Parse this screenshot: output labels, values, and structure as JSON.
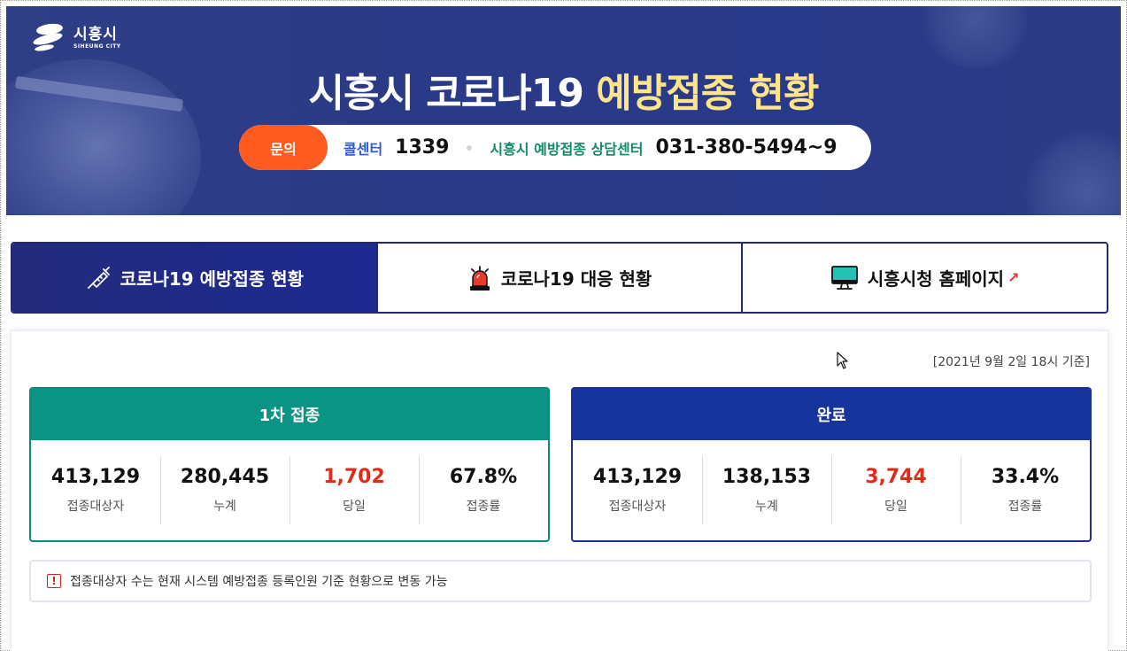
{
  "banner": {
    "logo_ko": "시흥시",
    "logo_en": "SIHEUNG CITY",
    "title_main": "시흥시 코로나19 ",
    "title_highlight": "예방접종 현황",
    "contact": {
      "ask_label": "문의",
      "call_center_label": "콜센터",
      "call_center_number": "1339",
      "consult_label": "시흥시 예방접종 상담센터",
      "consult_number": "031-380-5494~9"
    }
  },
  "tabs": [
    {
      "label": "코로나19 예방접종 현황",
      "icon": "syringe-icon",
      "active": true
    },
    {
      "label": "코로나19 대응 현황",
      "icon": "siren-icon",
      "active": false
    },
    {
      "label": "시흥시청 홈페이지",
      "icon": "monitor-icon",
      "active": false,
      "external_icon": "external-link-icon"
    }
  ],
  "status": {
    "timestamp": "[2021년 9월 2일 18시 기준]",
    "cards": [
      {
        "title": "1차 접종",
        "stats": [
          {
            "value": "413,129",
            "label": "접종대상자"
          },
          {
            "value": "280,445",
            "label": "누계"
          },
          {
            "value": "1,702",
            "label": "당일"
          },
          {
            "value": "67.8%",
            "label": "접종률"
          }
        ]
      },
      {
        "title": "완료",
        "stats": [
          {
            "value": "413,129",
            "label": "접종대상자"
          },
          {
            "value": "138,153",
            "label": "누계"
          },
          {
            "value": "3,744",
            "label": "당일"
          },
          {
            "value": "33.4%",
            "label": "접종률"
          }
        ]
      }
    ],
    "notice": "접종대상자 수는 현재 시스템 예방접종 등록인원 기준 현황으로 변동 가능",
    "notice_icon": "!"
  },
  "colors": {
    "banner_bg": "#2b3a86",
    "highlight": "#ffe58a",
    "ask_orange": "#ff5a1f",
    "first_dose": "#0b9384",
    "completed": "#17339c",
    "today_red": "#e02b1b"
  }
}
